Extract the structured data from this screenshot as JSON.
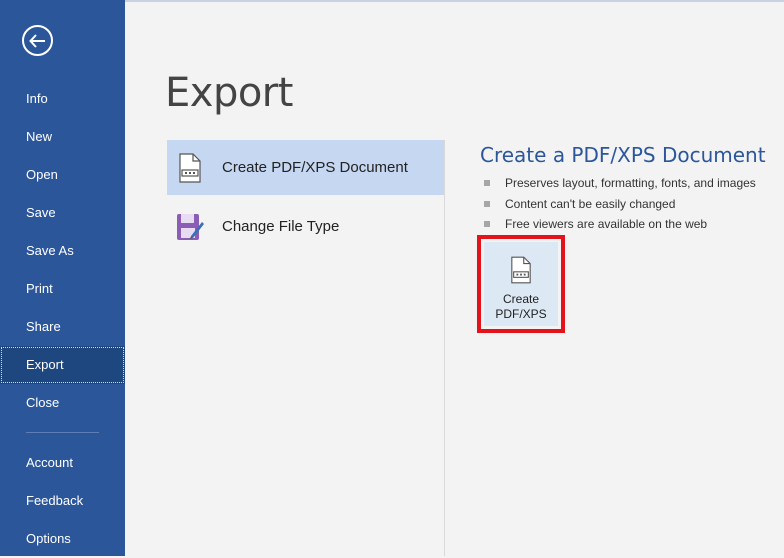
{
  "sidebar": {
    "back_icon": "arrow-left-icon",
    "items": [
      {
        "label": "Info"
      },
      {
        "label": "New"
      },
      {
        "label": "Open"
      },
      {
        "label": "Save"
      },
      {
        "label": "Save As"
      },
      {
        "label": "Print"
      },
      {
        "label": "Share"
      },
      {
        "label": "Export"
      },
      {
        "label": "Close"
      },
      {
        "label": "Account"
      },
      {
        "label": "Feedback"
      },
      {
        "label": "Options"
      }
    ],
    "active_item": "Export",
    "color": "#2b579a"
  },
  "page": {
    "title": "Export"
  },
  "export_options": [
    {
      "label": "Create PDF/XPS Document",
      "icon": "pdf-document-icon",
      "selected": true
    },
    {
      "label": "Change File Type",
      "icon": "save-disk-icon",
      "selected": false
    }
  ],
  "detail": {
    "title": "Create a PDF/XPS Document",
    "bullets": [
      "Preserves layout, formatting, fonts, and images",
      "Content can't be easily changed",
      "Free viewers are available on the web"
    ],
    "button": {
      "line1": "Create",
      "line2": "PDF/XPS",
      "icon": "pdf-document-icon",
      "highlight_color": "#e3121b"
    }
  }
}
